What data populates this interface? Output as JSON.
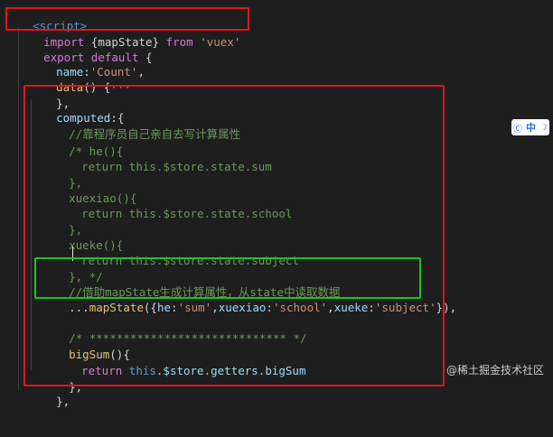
{
  "code": {
    "l0": "<script>",
    "l1_import": "import",
    "l1_names": " {mapState} ",
    "l1_from": "from",
    "l1_str": " 'vuex'",
    "l2_export": "export",
    "l2_default": " default",
    "l2_brace": " {",
    "l3_key": "name",
    "l3_colon": ":",
    "l3_str": "'Count'",
    "l3_comma": ",",
    "l4_fn": "data",
    "l4_rest": "() {",
    "l4_fold": "···",
    "l5": "},",
    "l6_key": "computed",
    "l6_rest": ":{",
    "l7": "//靠程序员自己亲自去写计算属性",
    "l8": "/* he(){",
    "l9": "return this.$store.state.sum",
    "l10": "},",
    "l11": "xuexiao(){",
    "l12": "return this.$store.state.school",
    "l13": "},",
    "l14": "xueke(){",
    "l15": "return this.$store.state.subject",
    "l16": "}, */",
    "l17": "//借助mapState生成计算属性，从state中读取数据",
    "l18_spread": "...",
    "l18_fn": "mapState",
    "l18_open": "({",
    "l18_k1": "he",
    "l18_c1": ":",
    "l18_v1": "'sum'",
    "l18_sep1": ",",
    "l18_k2": "xuexiao",
    "l18_c2": ":",
    "l18_v2": "'school'",
    "l18_sep2": ",",
    "l18_k3": "xueke",
    "l18_c3": ":",
    "l18_v3": "'subject'",
    "l18_close": "}),",
    "l19": "/* ***************************** */",
    "l20_fn": "bigSum",
    "l20_rest": "(){",
    "l21_return": "return",
    "l21_this": " this",
    "l21_rest": ".$store.getters.bigSum",
    "l22": "},",
    "l23": "},"
  },
  "ime": {
    "icon": "Ⓒ",
    "lang": "中",
    "mode": "☽"
  },
  "watermark": "@稀土掘金技术社区"
}
